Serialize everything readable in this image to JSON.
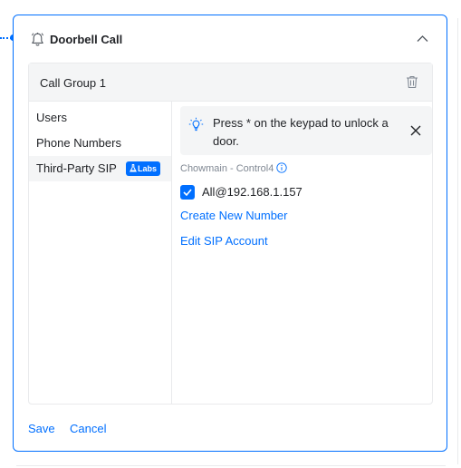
{
  "card": {
    "title": "Doorbell Call",
    "bell_icon": "bell-icon",
    "collapse_icon": "chevron-up-icon"
  },
  "group": {
    "title": "Call Group 1",
    "delete_icon": "trash-icon"
  },
  "nav": {
    "items": [
      {
        "label": "Users",
        "active": false
      },
      {
        "label": "Phone Numbers",
        "active": false
      },
      {
        "label": "Third-Party SIP",
        "active": true,
        "badge": "Labs"
      }
    ]
  },
  "tip": {
    "icon": "lightbulb-icon",
    "text": "Press * on the keypad to unlock a door.",
    "close_icon": "close-icon"
  },
  "sip": {
    "label": "Chowmain - Control4",
    "info_icon": "info-icon",
    "accounts": [
      {
        "name": "All@192.168.1.157",
        "checked": true
      }
    ],
    "create_link": "Create New Number",
    "edit_link": "Edit SIP Account"
  },
  "footer": {
    "save": "Save",
    "cancel": "Cancel"
  },
  "colors": {
    "accent": "#006fff",
    "panel": "#f4f5f6",
    "border": "#e9eaec",
    "muted_text": "#808893"
  }
}
